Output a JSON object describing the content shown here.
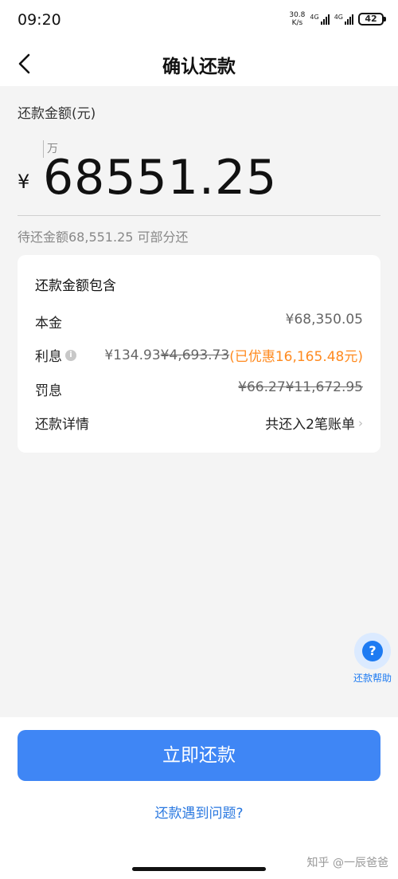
{
  "status_bar": {
    "time": "09:20",
    "net_speed_value": "30.8",
    "net_speed_unit": "K/s",
    "signal_1": "4G",
    "signal_2": "4G",
    "battery": "42"
  },
  "header": {
    "back_icon": "chevron-left-icon",
    "title": "确认还款"
  },
  "amount": {
    "label": "还款金额(元)",
    "unit_hint": "万",
    "currency_symbol": "¥",
    "value": "68551.25",
    "pending_text": "待还金额68,551.25 可部分还"
  },
  "breakdown": {
    "title": "还款金额包含",
    "principal": {
      "label": "本金",
      "value": "¥68,350.05"
    },
    "interest": {
      "label": "利息",
      "info_icon": "info-icon",
      "current": "¥134.93",
      "original": "¥4,693.73",
      "discount": "(已优惠16,165.48元)"
    },
    "penalty": {
      "label": "罚息",
      "current": "¥66.27",
      "original": "¥11,672.95"
    },
    "details": {
      "label": "还款详情",
      "value": "共还入2笔账单",
      "chevron_icon": "chevron-right-icon"
    }
  },
  "help": {
    "icon": "question-icon",
    "label": "还款帮助"
  },
  "actions": {
    "pay_button": "立即还款",
    "problem_link": "还款遇到问题?"
  },
  "watermark": "知乎 @一辰爸爸",
  "colors": {
    "primary_button": "#3f86f5",
    "link": "#2a78e0",
    "discount": "#ff8a1f",
    "background": "#f4f4f4"
  }
}
